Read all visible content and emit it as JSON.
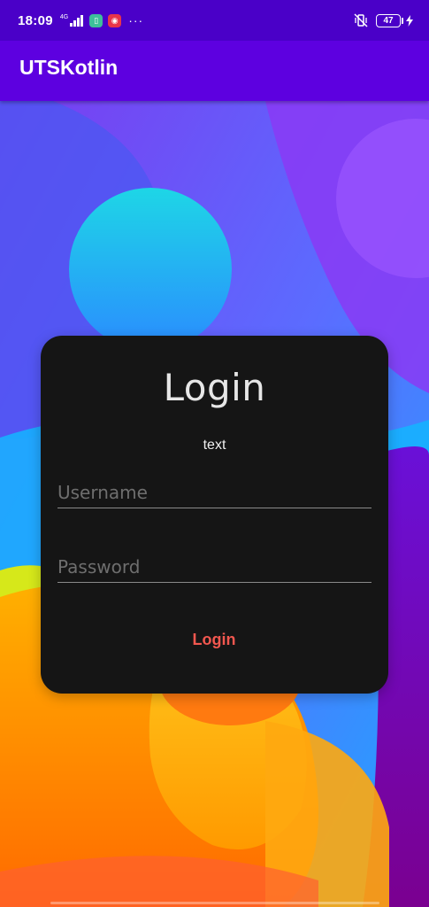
{
  "status_bar": {
    "time": "18:09",
    "network_type": "4G",
    "battery_level": "47",
    "more_indicator": "···",
    "icons": [
      "signal-icon",
      "app-notification-icon",
      "screen-record-icon",
      "vibrate-icon",
      "battery-icon",
      "charging-bolt-icon"
    ],
    "colors": {
      "background": "#4a00c8",
      "badge_green": "#3dbf9a",
      "badge_red": "#e8344a"
    }
  },
  "app_bar": {
    "title": "UTSKotlin",
    "color": "#5d00e0"
  },
  "login_card": {
    "heading": "Login",
    "label_text": "text",
    "username": {
      "placeholder": "Username",
      "value": ""
    },
    "password": {
      "placeholder": "Password",
      "value": ""
    },
    "login_button_label": "Login",
    "colors": {
      "card_background": "#151515",
      "button_text": "#f2574f"
    }
  }
}
